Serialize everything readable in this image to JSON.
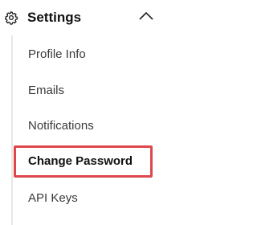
{
  "section": {
    "title": "Settings",
    "icon": "gear-icon",
    "toggle_icon": "chevron-up-icon",
    "expanded": true
  },
  "menu": {
    "items": [
      {
        "label": "Profile Info",
        "active": false
      },
      {
        "label": "Emails",
        "active": false
      },
      {
        "label": "Notifications",
        "active": false
      },
      {
        "label": "Change Password",
        "active": true,
        "highlighted": true
      },
      {
        "label": "API Keys",
        "active": false
      }
    ]
  },
  "colors": {
    "highlight": "#e0474c",
    "text": "#3a3a3a",
    "active_text": "#111111",
    "divider": "#e8e8e8"
  }
}
